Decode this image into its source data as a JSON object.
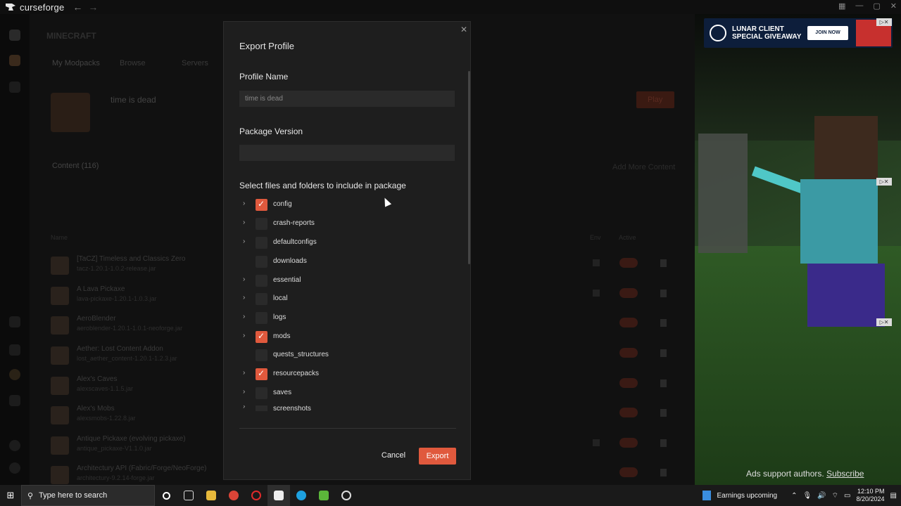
{
  "app": {
    "name": "curseforge"
  },
  "background": {
    "instance_title": "time is dead",
    "tabs": [
      "My Modpacks",
      "Browse",
      "Servers"
    ],
    "content_label": "Content (116)",
    "add_more": "Add More Content",
    "play_label": "Play",
    "col_name": "Name",
    "col_env": "Env",
    "col_active": "Active",
    "rows": [
      {
        "title": "[TaCZ] Timeless and Classics Zero",
        "file": "tacz-1.20.1-1.0.2-release.jar"
      },
      {
        "title": "A Lava Pickaxe",
        "file": "lava-pickaxe-1.20.1-1.0.3.jar"
      },
      {
        "title": "AeroBlender",
        "file": "aeroblender-1.20.1-1.0.1-neoforge.jar"
      },
      {
        "title": "Aether: Lost Content Addon",
        "file": "lost_aether_content-1.20.1-1.2.3.jar"
      },
      {
        "title": "Alex's Caves",
        "file": "alexscaves-1.1.5.jar"
      },
      {
        "title": "Alex's Mobs",
        "file": "alexsmobs-1.22.8.jar"
      },
      {
        "title": "Antique Pickaxe (evolving pickaxe)",
        "file": "antique_pickaxe-V1.1.0.jar"
      },
      {
        "title": "Architectury API (Fabric/Forge/NeoForge)",
        "file": "architectury-9.2.14-forge.jar"
      }
    ]
  },
  "modal": {
    "title": "Export Profile",
    "profile_name_label": "Profile Name",
    "profile_name_placeholder": "time is dead",
    "package_version_label": "Package Version",
    "package_version_value": "",
    "include_label": "Select files and folders to include in package",
    "items": [
      {
        "name": "config",
        "expandable": true,
        "checked": true
      },
      {
        "name": "crash-reports",
        "expandable": true,
        "checked": false
      },
      {
        "name": "defaultconfigs",
        "expandable": true,
        "checked": false
      },
      {
        "name": "downloads",
        "expandable": false,
        "checked": false
      },
      {
        "name": "essential",
        "expandable": true,
        "checked": false
      },
      {
        "name": "local",
        "expandable": true,
        "checked": false
      },
      {
        "name": "logs",
        "expandable": true,
        "checked": false
      },
      {
        "name": "mods",
        "expandable": true,
        "checked": true
      },
      {
        "name": "quests_structures",
        "expandable": false,
        "checked": false
      },
      {
        "name": "resourcepacks",
        "expandable": true,
        "checked": true
      },
      {
        "name": "saves",
        "expandable": true,
        "checked": false
      },
      {
        "name": "screenshots",
        "expandable": true,
        "checked": false
      }
    ],
    "cancel_label": "Cancel",
    "export_label": "Export"
  },
  "ad": {
    "title_line1": "LUNAR CLIENT",
    "title_line2": "SPECIAL GIVEAWAY",
    "button": "JOIN NOW",
    "support_text": "Ads support authors.",
    "subscribe": "Subscribe"
  },
  "taskbar": {
    "search_placeholder": "Type here to search",
    "news": "Earnings upcoming",
    "time": "12:10 PM",
    "date": "8/20/2024"
  },
  "colors": {
    "accent": "#e0593d",
    "modal_bg": "#1e1e1e",
    "field_bg": "#2a2a2a"
  }
}
